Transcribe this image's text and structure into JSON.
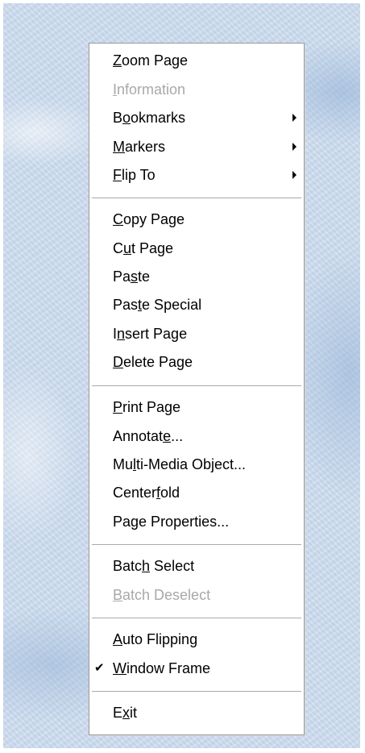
{
  "menu": {
    "items": [
      {
        "label": "Zoom Page",
        "mnemonic": "Z",
        "disabled": false
      },
      {
        "label": "Information",
        "mnemonic": "I",
        "disabled": true
      },
      {
        "label": "Bookmarks",
        "mnemonic": "o",
        "disabled": false,
        "submenu": true
      },
      {
        "label": "Markers",
        "mnemonic": "M",
        "disabled": false,
        "submenu": true
      },
      {
        "label": "Flip To",
        "mnemonic": "F",
        "disabled": false,
        "submenu": true
      },
      {
        "label": "Copy Page",
        "mnemonic": "C",
        "disabled": false
      },
      {
        "label": "Cut Page",
        "mnemonic": "u",
        "disabled": false
      },
      {
        "label": "Paste",
        "mnemonic": "s",
        "disabled": false
      },
      {
        "label": "Paste Special",
        "mnemonic": "t",
        "disabled": false
      },
      {
        "label": "Insert Page",
        "mnemonic": "n",
        "disabled": false
      },
      {
        "label": "Delete Page",
        "mnemonic": "D",
        "disabled": false
      },
      {
        "label": "Print Page",
        "mnemonic": "P",
        "disabled": false
      },
      {
        "label": "Annotate...",
        "mnemonic": "e",
        "disabled": false
      },
      {
        "label": "Multi-Media Object...",
        "mnemonic": "l",
        "disabled": false
      },
      {
        "label": "Centerfold",
        "mnemonic": "f",
        "disabled": false
      },
      {
        "label": "Page Properties...",
        "mnemonic": "g",
        "disabled": false
      },
      {
        "label": "Batch Select",
        "mnemonic": "h",
        "disabled": false
      },
      {
        "label": "Batch Deselect",
        "mnemonic": "B",
        "disabled": true
      },
      {
        "label": "Auto Flipping",
        "mnemonic": "A",
        "disabled": false
      },
      {
        "label": "Window Frame",
        "mnemonic": "W",
        "disabled": false,
        "checked": true
      },
      {
        "label": "Exit",
        "mnemonic": "x",
        "disabled": false
      }
    ],
    "check_glyph": "✔",
    "colors": {
      "text": "#000000",
      "disabled_text": "#a8a8a8",
      "separator": "#a9a9a9",
      "background": "#ffffff"
    }
  }
}
